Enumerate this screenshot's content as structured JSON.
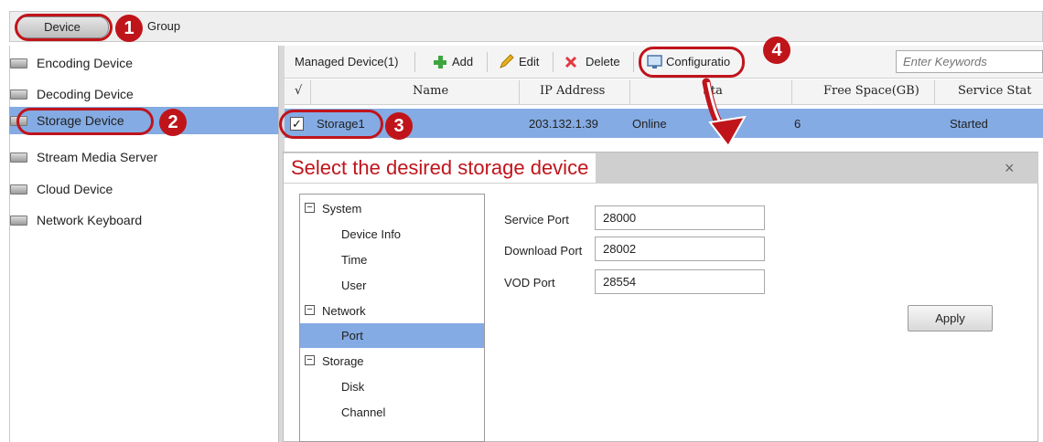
{
  "tabs": {
    "device": "Device",
    "group": "Group"
  },
  "sidebar": {
    "items": [
      {
        "label": "Encoding Device",
        "icon": "encoder-icon"
      },
      {
        "label": "Decoding Device",
        "icon": "decoder-icon"
      },
      {
        "label": "Storage Device",
        "icon": "storage-icon",
        "selected": true
      },
      {
        "label": "Stream Media Server",
        "icon": "server-icon"
      },
      {
        "label": "Cloud Device",
        "icon": "cloud-device-icon"
      },
      {
        "label": "Network Keyboard",
        "icon": "keyboard-icon"
      }
    ]
  },
  "toolbar": {
    "managed": "Managed Device(1)",
    "add": "Add",
    "edit": "Edit",
    "delete": "Delete",
    "configuration": "Configuratio",
    "search_placeholder": "Enter Keywords"
  },
  "table": {
    "columns": [
      "√",
      "Name",
      "IP Address",
      "Sta",
      "Free Space(GB)",
      "Service Stat"
    ],
    "rows": [
      {
        "checked": true,
        "name": "Storage1",
        "ip": "203.132.1.39",
        "status": "Online",
        "free_space": "6",
        "service_status": "Started"
      }
    ]
  },
  "dialog": {
    "annotation": "Select the desired storage device",
    "close": "×",
    "tree": {
      "system": "System",
      "device_info": "Device Info",
      "time": "Time",
      "user": "User",
      "network": "Network",
      "port": "Port",
      "storage": "Storage",
      "disk": "Disk",
      "channel": "Channel",
      "collapse_glyph": "−"
    },
    "fields": {
      "service_port_label": "Service Port",
      "service_port_value": "28000",
      "download_port_label": "Download Port",
      "download_port_value": "28002",
      "vod_port_label": "VOD Port",
      "vod_port_value": "28554"
    },
    "apply": "Apply"
  },
  "callouts": [
    "1",
    "2",
    "3",
    "4"
  ],
  "colors": {
    "accent_red": "#c0141b",
    "selection_blue": "#84abe3"
  }
}
